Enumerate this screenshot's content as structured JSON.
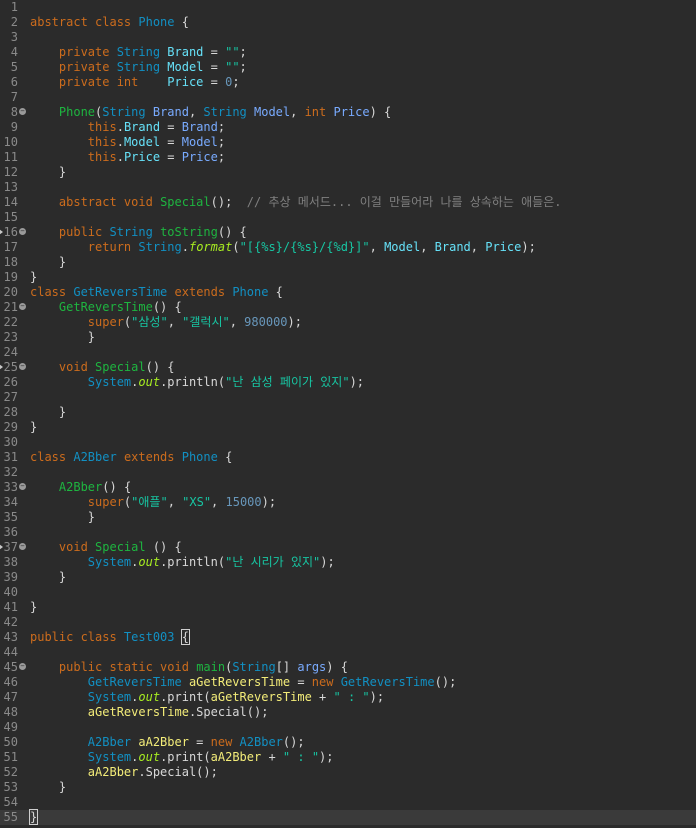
{
  "editor": {
    "language": "java",
    "current_line": 55,
    "lines": [
      {
        "n": "1",
        "t": []
      },
      {
        "n": "2",
        "t": [
          [
            "kw",
            "abstract class "
          ],
          [
            "ty",
            "Phone"
          ],
          [
            "pl",
            " {"
          ]
        ]
      },
      {
        "n": "3",
        "t": []
      },
      {
        "n": "4",
        "t": [
          [
            "pl",
            "    "
          ],
          [
            "kw",
            "private "
          ],
          [
            "ty",
            "String "
          ],
          [
            "field",
            "Brand"
          ],
          [
            "pl",
            " = "
          ],
          [
            "str",
            "\"\""
          ],
          [
            "pl",
            ";"
          ]
        ]
      },
      {
        "n": "5",
        "t": [
          [
            "pl",
            "    "
          ],
          [
            "kw",
            "private "
          ],
          [
            "ty",
            "String "
          ],
          [
            "field",
            "Model"
          ],
          [
            "pl",
            " = "
          ],
          [
            "str",
            "\"\""
          ],
          [
            "pl",
            ";"
          ]
        ]
      },
      {
        "n": "6",
        "t": [
          [
            "pl",
            "    "
          ],
          [
            "kw",
            "private int    "
          ],
          [
            "field",
            "Price"
          ],
          [
            "pl",
            " = "
          ],
          [
            "num",
            "0"
          ],
          [
            "pl",
            ";"
          ]
        ]
      },
      {
        "n": "7",
        "t": []
      },
      {
        "n": "8",
        "fold": true,
        "t": [
          [
            "pl",
            "    "
          ],
          [
            "fn",
            "Phone"
          ],
          [
            "pl",
            "("
          ],
          [
            "ty",
            "String "
          ],
          [
            "param",
            "Brand"
          ],
          [
            "pl",
            ", "
          ],
          [
            "ty",
            "String "
          ],
          [
            "param",
            "Model"
          ],
          [
            "pl",
            ", "
          ],
          [
            "kw",
            "int "
          ],
          [
            "param",
            "Price"
          ],
          [
            "pl",
            ") {"
          ]
        ]
      },
      {
        "n": "9",
        "t": [
          [
            "pl",
            "        "
          ],
          [
            "kw",
            "this"
          ],
          [
            "pl",
            "."
          ],
          [
            "field",
            "Brand"
          ],
          [
            "pl",
            " = "
          ],
          [
            "param",
            "Brand"
          ],
          [
            "pl",
            ";"
          ]
        ]
      },
      {
        "n": "10",
        "t": [
          [
            "pl",
            "        "
          ],
          [
            "kw",
            "this"
          ],
          [
            "pl",
            "."
          ],
          [
            "field",
            "Model"
          ],
          [
            "pl",
            " = "
          ],
          [
            "param",
            "Model"
          ],
          [
            "pl",
            ";"
          ]
        ]
      },
      {
        "n": "11",
        "t": [
          [
            "pl",
            "        "
          ],
          [
            "kw",
            "this"
          ],
          [
            "pl",
            "."
          ],
          [
            "field",
            "Price"
          ],
          [
            "pl",
            " = "
          ],
          [
            "param",
            "Price"
          ],
          [
            "pl",
            ";"
          ]
        ]
      },
      {
        "n": "12",
        "t": [
          [
            "pl",
            "    }"
          ]
        ]
      },
      {
        "n": "13",
        "t": []
      },
      {
        "n": "14",
        "t": [
          [
            "pl",
            "    "
          ],
          [
            "kw",
            "abstract void "
          ],
          [
            "fn",
            "Special"
          ],
          [
            "pl",
            "();  "
          ],
          [
            "cm",
            "// 추상 메서드... 이걸 만들어라 나를 상속하는 애들은."
          ]
        ]
      },
      {
        "n": "15",
        "t": []
      },
      {
        "n": "16",
        "fold": true,
        "mark": true,
        "t": [
          [
            "pl",
            "    "
          ],
          [
            "kw",
            "public "
          ],
          [
            "ty",
            "String "
          ],
          [
            "fn",
            "toString"
          ],
          [
            "pl",
            "() {"
          ]
        ]
      },
      {
        "n": "17",
        "t": [
          [
            "pl",
            "        "
          ],
          [
            "kw",
            "return "
          ],
          [
            "ty",
            "String"
          ],
          [
            "pl",
            "."
          ],
          [
            "it",
            "format"
          ],
          [
            "pl",
            "("
          ],
          [
            "str",
            "\"[{%s}/{%s}/{%d}]\""
          ],
          [
            "pl",
            ", "
          ],
          [
            "field",
            "Model"
          ],
          [
            "pl",
            ", "
          ],
          [
            "field",
            "Brand"
          ],
          [
            "pl",
            ", "
          ],
          [
            "field",
            "Price"
          ],
          [
            "pl",
            ");"
          ]
        ]
      },
      {
        "n": "18",
        "t": [
          [
            "pl",
            "    }"
          ]
        ]
      },
      {
        "n": "19",
        "t": [
          [
            "pl",
            "}"
          ]
        ]
      },
      {
        "n": "20",
        "t": [
          [
            "kw",
            "class "
          ],
          [
            "ty",
            "GetReversTime "
          ],
          [
            "kw",
            "extends "
          ],
          [
            "ty",
            "Phone"
          ],
          [
            "pl",
            " {"
          ]
        ]
      },
      {
        "n": "21",
        "fold": true,
        "t": [
          [
            "pl",
            "    "
          ],
          [
            "fn",
            "GetReversTime"
          ],
          [
            "pl",
            "() {"
          ]
        ]
      },
      {
        "n": "22",
        "t": [
          [
            "pl",
            "        "
          ],
          [
            "kw",
            "super"
          ],
          [
            "pl",
            "("
          ],
          [
            "str",
            "\"삼성\""
          ],
          [
            "pl",
            ", "
          ],
          [
            "str",
            "\"갤럭시\""
          ],
          [
            "pl",
            ", "
          ],
          [
            "num",
            "980000"
          ],
          [
            "pl",
            ");"
          ]
        ]
      },
      {
        "n": "23",
        "t": [
          [
            "pl",
            "        }"
          ]
        ]
      },
      {
        "n": "24",
        "t": []
      },
      {
        "n": "25",
        "fold": true,
        "mark": true,
        "t": [
          [
            "pl",
            "    "
          ],
          [
            "kw",
            "void "
          ],
          [
            "fn",
            "Special"
          ],
          [
            "pl",
            "() {"
          ]
        ]
      },
      {
        "n": "26",
        "t": [
          [
            "pl",
            "        "
          ],
          [
            "ty",
            "System"
          ],
          [
            "pl",
            "."
          ],
          [
            "it",
            "out"
          ],
          [
            "pl",
            ".println("
          ],
          [
            "str",
            "\"난 삼성 페이가 있지\""
          ],
          [
            "pl",
            ");"
          ]
        ]
      },
      {
        "n": "27",
        "t": []
      },
      {
        "n": "28",
        "t": [
          [
            "pl",
            "    }"
          ]
        ]
      },
      {
        "n": "29",
        "t": [
          [
            "pl",
            "}"
          ]
        ]
      },
      {
        "n": "30",
        "t": []
      },
      {
        "n": "31",
        "t": [
          [
            "kw",
            "class "
          ],
          [
            "ty",
            "A2Bber "
          ],
          [
            "kw",
            "extends "
          ],
          [
            "ty",
            "Phone"
          ],
          [
            "pl",
            " {"
          ]
        ]
      },
      {
        "n": "32",
        "t": []
      },
      {
        "n": "33",
        "fold": true,
        "t": [
          [
            "pl",
            "    "
          ],
          [
            "fn",
            "A2Bber"
          ],
          [
            "pl",
            "() {"
          ]
        ]
      },
      {
        "n": "34",
        "t": [
          [
            "pl",
            "        "
          ],
          [
            "kw",
            "super"
          ],
          [
            "pl",
            "("
          ],
          [
            "str",
            "\"애플\""
          ],
          [
            "pl",
            ", "
          ],
          [
            "str",
            "\"XS\""
          ],
          [
            "pl",
            ", "
          ],
          [
            "num",
            "15000"
          ],
          [
            "pl",
            ");"
          ]
        ]
      },
      {
        "n": "35",
        "t": [
          [
            "pl",
            "        }"
          ]
        ]
      },
      {
        "n": "36",
        "t": []
      },
      {
        "n": "37",
        "fold": true,
        "mark": true,
        "t": [
          [
            "pl",
            "    "
          ],
          [
            "kw",
            "void "
          ],
          [
            "fn",
            "Special"
          ],
          [
            "pl",
            " () {"
          ]
        ]
      },
      {
        "n": "38",
        "t": [
          [
            "pl",
            "        "
          ],
          [
            "ty",
            "System"
          ],
          [
            "pl",
            "."
          ],
          [
            "it",
            "out"
          ],
          [
            "pl",
            ".println("
          ],
          [
            "str",
            "\"난 시리가 있지\""
          ],
          [
            "pl",
            ");"
          ]
        ]
      },
      {
        "n": "39",
        "t": [
          [
            "pl",
            "    }"
          ]
        ]
      },
      {
        "n": "40",
        "t": []
      },
      {
        "n": "41",
        "t": [
          [
            "pl",
            "}"
          ]
        ]
      },
      {
        "n": "42",
        "t": []
      },
      {
        "n": "43",
        "t": [
          [
            "kw",
            "public class "
          ],
          [
            "ty",
            "Test003 "
          ],
          [
            "brk",
            "{"
          ]
        ]
      },
      {
        "n": "44",
        "t": []
      },
      {
        "n": "45",
        "fold": true,
        "t": [
          [
            "pl",
            "    "
          ],
          [
            "kw",
            "public static void "
          ],
          [
            "fn",
            "main"
          ],
          [
            "pl",
            "("
          ],
          [
            "ty",
            "String"
          ],
          [
            "pl",
            "[] "
          ],
          [
            "param",
            "args"
          ],
          [
            "pl",
            ") {"
          ]
        ]
      },
      {
        "n": "46",
        "t": [
          [
            "pl",
            "        "
          ],
          [
            "ty",
            "GetReversTime "
          ],
          [
            "local",
            "aGetReversTime"
          ],
          [
            "pl",
            " = "
          ],
          [
            "kw",
            "new "
          ],
          [
            "ty",
            "GetReversTime"
          ],
          [
            "pl",
            "();"
          ]
        ]
      },
      {
        "n": "47",
        "t": [
          [
            "pl",
            "        "
          ],
          [
            "ty",
            "System"
          ],
          [
            "pl",
            "."
          ],
          [
            "it",
            "out"
          ],
          [
            "pl",
            ".print("
          ],
          [
            "local",
            "aGetReversTime"
          ],
          [
            "pl",
            " + "
          ],
          [
            "str",
            "\" : \""
          ],
          [
            "pl",
            ");"
          ]
        ]
      },
      {
        "n": "48",
        "t": [
          [
            "pl",
            "        "
          ],
          [
            "local",
            "aGetReversTime"
          ],
          [
            "pl",
            ".Special();"
          ]
        ]
      },
      {
        "n": "49",
        "t": []
      },
      {
        "n": "50",
        "t": [
          [
            "pl",
            "        "
          ],
          [
            "ty",
            "A2Bber "
          ],
          [
            "local",
            "aA2Bber"
          ],
          [
            "pl",
            " = "
          ],
          [
            "kw",
            "new "
          ],
          [
            "ty",
            "A2Bber"
          ],
          [
            "pl",
            "();"
          ]
        ]
      },
      {
        "n": "51",
        "t": [
          [
            "pl",
            "        "
          ],
          [
            "ty",
            "System"
          ],
          [
            "pl",
            "."
          ],
          [
            "it",
            "out"
          ],
          [
            "pl",
            ".print("
          ],
          [
            "local",
            "aA2Bber"
          ],
          [
            "pl",
            " + "
          ],
          [
            "str",
            "\" : \""
          ],
          [
            "pl",
            ");"
          ]
        ]
      },
      {
        "n": "52",
        "t": [
          [
            "pl",
            "        "
          ],
          [
            "local",
            "aA2Bber"
          ],
          [
            "pl",
            ".Special();"
          ]
        ]
      },
      {
        "n": "53",
        "t": [
          [
            "pl",
            "    }"
          ]
        ]
      },
      {
        "n": "54",
        "t": []
      },
      {
        "n": "55",
        "t": [
          [
            "brk",
            "}"
          ],
          [
            "cursor",
            ""
          ]
        ]
      }
    ]
  }
}
